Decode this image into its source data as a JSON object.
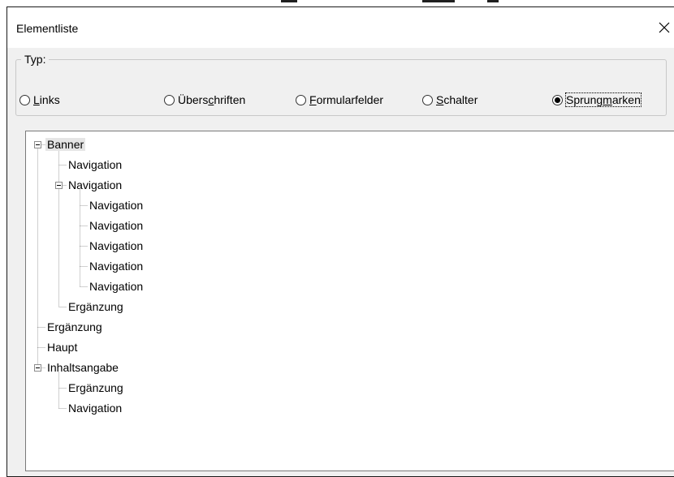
{
  "window": {
    "title": "Elementliste",
    "close_glyph": "✕"
  },
  "typ_group": {
    "label": "Typ:",
    "options": [
      {
        "pre": "",
        "accel": "L",
        "post": "inks",
        "checked": false
      },
      {
        "pre": "Übers",
        "accel": "c",
        "post": "hriften",
        "checked": false
      },
      {
        "pre": "",
        "accel": "F",
        "post": "ormularfelder",
        "checked": false
      },
      {
        "pre": "",
        "accel": "S",
        "post": "chalter",
        "checked": false
      },
      {
        "pre": "Sprung",
        "accel": "m",
        "post": "arken",
        "checked": true
      }
    ]
  },
  "tree": {
    "nodes": [
      {
        "label": "Banner",
        "level": 0,
        "expanded": true,
        "selected": true
      },
      {
        "label": "Navigation",
        "level": 1
      },
      {
        "label": "Navigation",
        "level": 1,
        "expanded": true
      },
      {
        "label": "Navigation",
        "level": 2
      },
      {
        "label": "Navigation",
        "level": 2
      },
      {
        "label": "Navigation",
        "level": 2
      },
      {
        "label": "Navigation",
        "level": 2
      },
      {
        "label": "Navigation",
        "level": 2
      },
      {
        "label": "Ergänzung",
        "level": 1
      },
      {
        "label": "Ergänzung",
        "level": 0
      },
      {
        "label": "Haupt",
        "level": 0
      },
      {
        "label": "Inhaltsangabe",
        "level": 0,
        "expanded": true
      },
      {
        "label": "Ergänzung",
        "level": 1
      },
      {
        "label": "Navigation",
        "level": 1
      }
    ]
  },
  "colors": {
    "dialog_bg": "#f0f0f0",
    "tree_bg": "#ffffff",
    "selection_bg": "#e5e5e5",
    "border": "#7a7a7a",
    "tree_lines": "#a0a0a0"
  }
}
